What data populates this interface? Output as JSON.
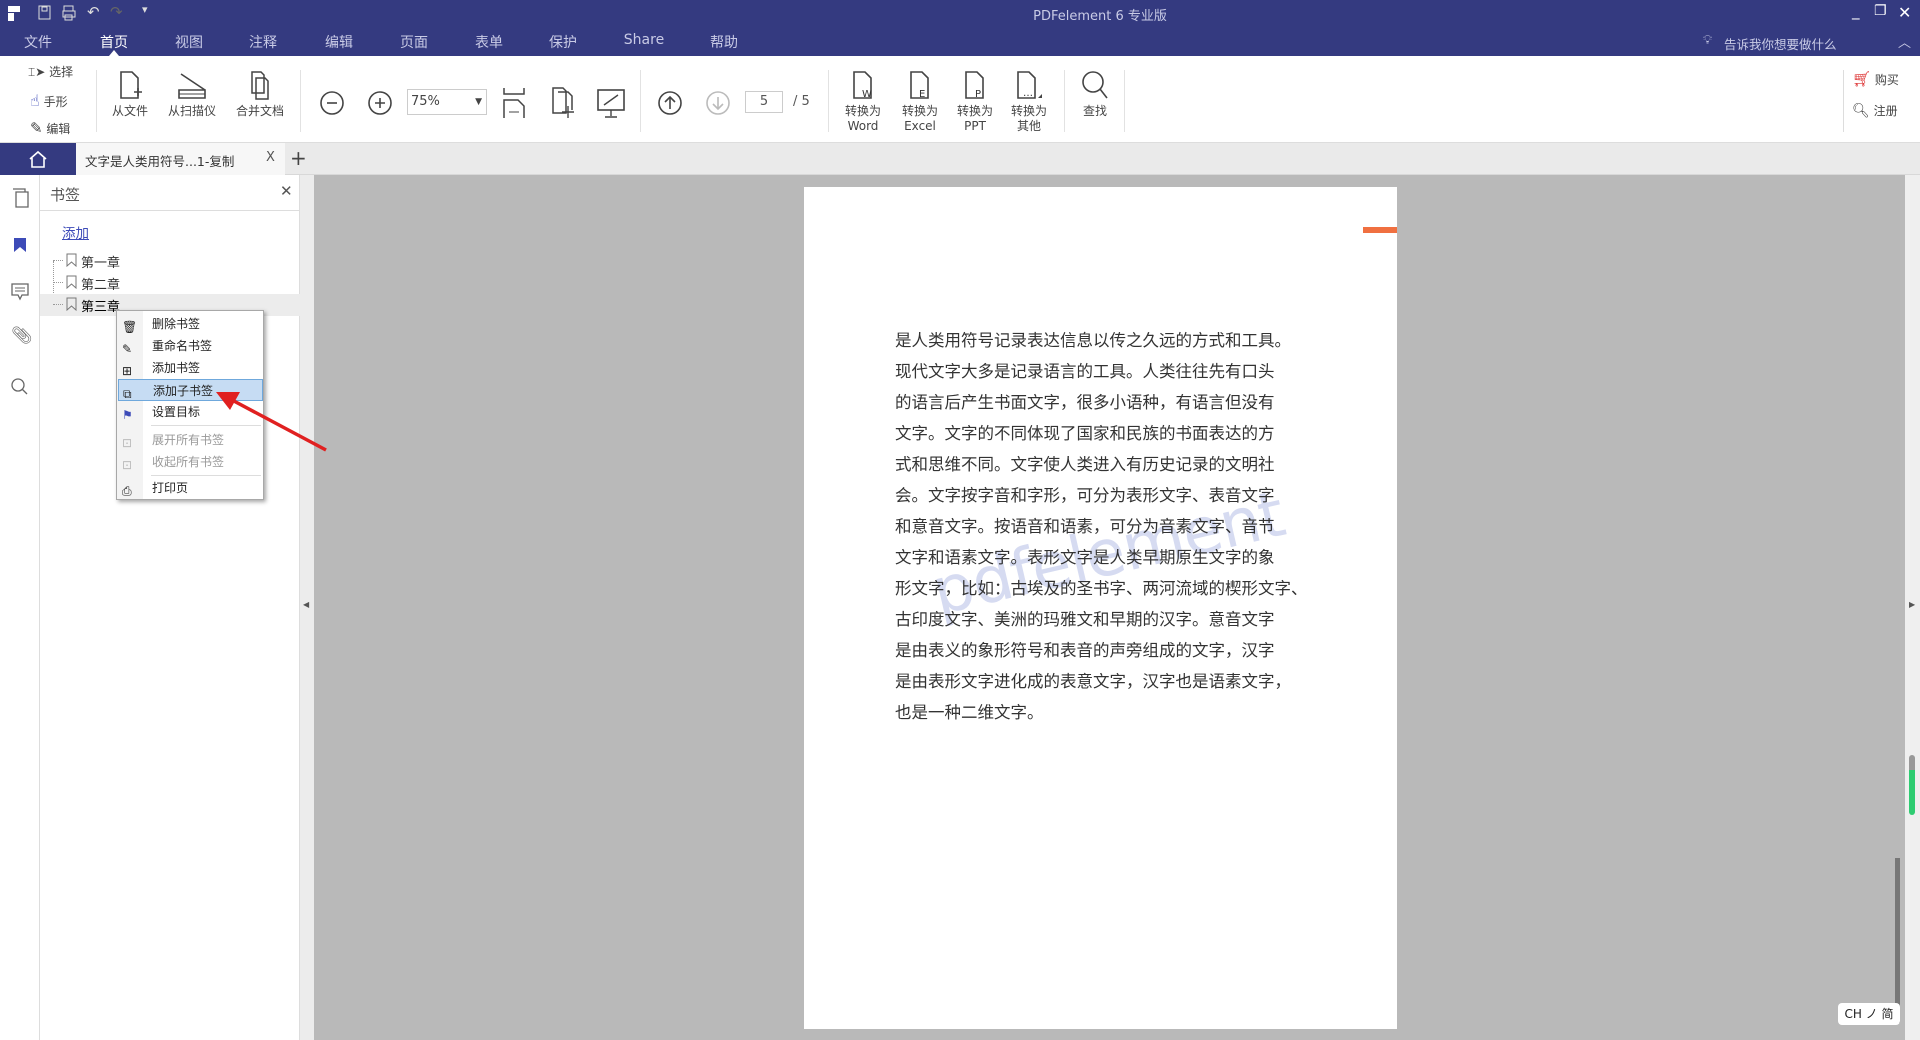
{
  "window": {
    "title": "PDFelement  6 专业版"
  },
  "menu": {
    "items": [
      "文件",
      "首页",
      "视图",
      "注释",
      "编辑",
      "页面",
      "表单",
      "保护",
      "Share",
      "帮助"
    ],
    "active": "首页",
    "tell_me": "告诉我你想要做什么"
  },
  "toolbar": {
    "select": "选择",
    "hand": "手形",
    "edit": "编辑",
    "from_file": "从文件",
    "from_scanner": "从扫描仪",
    "combine": "合并文档",
    "zoom": "75%",
    "page_current": "5",
    "page_total": "/ 5",
    "to_word": [
      "转换为",
      "Word"
    ],
    "to_excel": [
      "转换为",
      "Excel"
    ],
    "to_ppt": [
      "转换为",
      "PPT"
    ],
    "to_other": [
      "转换为",
      "其他"
    ],
    "find": "查找",
    "buy": "购买",
    "register": "注册"
  },
  "tabs": {
    "document": "文字是人类用符号...1-复制",
    "close": "X",
    "add": "+"
  },
  "bookmarks": {
    "title": "书签",
    "add": "添加",
    "items": [
      "第一章",
      "第二章",
      "第三章"
    ],
    "selected": "第三章"
  },
  "context_menu": {
    "items": [
      {
        "label": "删除书签",
        "icon": "trash-icon",
        "enabled": true
      },
      {
        "label": "重命名书签",
        "icon": "pencil-icon",
        "enabled": true
      },
      {
        "label": "添加书签",
        "icon": "bookmark-add-icon",
        "enabled": true
      },
      {
        "label": "添加子书签",
        "icon": "child-bookmark-icon",
        "enabled": true,
        "highlighted": true
      },
      {
        "label": "设置目标",
        "icon": "flag-icon",
        "enabled": true
      },
      {
        "label": "展开所有书签",
        "icon": "expand-icon",
        "enabled": false
      },
      {
        "label": "收起所有书签",
        "icon": "collapse-icon",
        "enabled": false
      },
      {
        "label": "打印页",
        "icon": "print-icon",
        "enabled": true
      }
    ]
  },
  "document": {
    "lines": [
      "是人类用符号记录表达信息以传之久远的方式和工具。",
      "现代文字大多是记录语言的工具。人类往往先有口头",
      "的语言后产生书面文字，很多小语种，有语言但没有",
      "文字。文字的不同体现了国家和民族的书面表达的方",
      "式和思维不同。文字使人类进入有历史记录的文明社",
      "会。文字按字音和字形，可分为表形文字、表音文字",
      "和意音文字。按语音和语素，可分为音素文字、音节",
      "文字和语素文字。表形文字是人类早期原生文字的象",
      "形文字，比如：古埃及的圣书字、两河流域的楔形文字、",
      "古印度文字、美洲的玛雅文和早期的汉字。意音文字",
      "是由表义的象形符号和表音的声旁组成的文字，汉字",
      "是由表形文字进化成的表意文字，汉字也是语素文字，",
      "也是一种二维文字。"
    ],
    "watermark": "pdfelement"
  },
  "ime": "CH ノ 简",
  "colors": {
    "titlebar": "#343a80",
    "accent": "#3d4bb8",
    "highlight": "#c6dcf3",
    "arrow": "#e02020"
  }
}
